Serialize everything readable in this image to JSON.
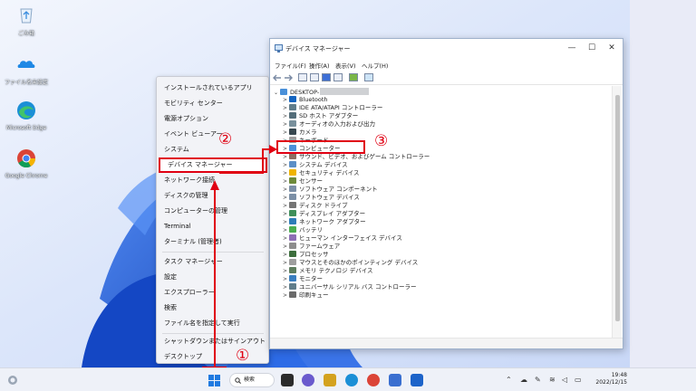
{
  "desktop": {
    "icons": [
      {
        "label": "ごみ箱",
        "icon": "recycle-bin-icon"
      },
      {
        "label": "ファイル名未設定",
        "icon": "onedrive-icon"
      },
      {
        "label": "Microsoft Edge",
        "icon": "edge-icon"
      },
      {
        "label": "Google Chrome",
        "icon": "chrome-icon"
      }
    ]
  },
  "context_menu": {
    "items": [
      "インストールされているアプリ",
      "モビリティ センター",
      "電源オプション",
      "イベント ビューアー",
      "システム",
      "デバイス マネージャー",
      "ネットワーク接続",
      "ディスクの管理",
      "コンピューターの管理",
      "Terminal",
      "ターミナル (管理者)",
      "タスク マネージャー",
      "設定",
      "エクスプローラー",
      "検索",
      "ファイル名を指定して実行",
      "シャットダウンまたはサインアウト",
      "デスクトップ"
    ],
    "highlighted": "デバイス マネージャー"
  },
  "window": {
    "title": "デバイス マネージャー",
    "controls": {
      "minimize": "—",
      "maximize": "☐",
      "close": "✕"
    },
    "menu": [
      "ファイル(F)",
      "操作(A)",
      "表示(V)",
      "ヘルプ(H)"
    ],
    "root": "DESKTOP-",
    "devices": [
      {
        "label": "Bluetooth",
        "icon": "bluetooth-icon",
        "color": "#1565c0"
      },
      {
        "label": "IDE ATA/ATAPI コントローラー",
        "icon": "ide-controller-icon",
        "color": "#607d8b"
      },
      {
        "label": "SD ホスト アダプター",
        "icon": "sd-adapter-icon",
        "color": "#546e7a"
      },
      {
        "label": "オーディオの入力および出力",
        "icon": "speaker-icon",
        "color": "#78909c"
      },
      {
        "label": "カメラ",
        "icon": "camera-icon",
        "color": "#37474f"
      },
      {
        "label": "キーボード",
        "icon": "keyboard-icon",
        "color": "#9e9e9e"
      },
      {
        "label": "コンピューター",
        "icon": "computer-icon",
        "color": "#4a90d9"
      },
      {
        "label": "サウンド、ビデオ、およびゲーム コントローラー",
        "icon": "sound-icon",
        "color": "#8d6e63"
      },
      {
        "label": "システム デバイス",
        "icon": "system-device-icon",
        "color": "#5c8fc7"
      },
      {
        "label": "セキュリティ デバイス",
        "icon": "security-icon",
        "color": "#f0b400"
      },
      {
        "label": "センサー",
        "icon": "sensor-icon",
        "color": "#6d8a3a"
      },
      {
        "label": "ソフトウェア コンポーネント",
        "icon": "software-component-icon",
        "color": "#7b8fa6"
      },
      {
        "label": "ソフトウェア デバイス",
        "icon": "software-device-icon",
        "color": "#7b8fa6"
      },
      {
        "label": "ディスク ドライブ",
        "icon": "disk-drive-icon",
        "color": "#757575"
      },
      {
        "label": "ディスプレイ アダプター",
        "icon": "display-adapter-icon",
        "color": "#3f8f5a"
      },
      {
        "label": "ネットワーク アダプター",
        "icon": "network-adapter-icon",
        "color": "#2e7db8"
      },
      {
        "label": "バッテリ",
        "icon": "battery-icon",
        "color": "#4caf50"
      },
      {
        "label": "ヒューマン インターフェイス デバイス",
        "icon": "hid-icon",
        "color": "#8e6fb5"
      },
      {
        "label": "ファームウェア",
        "icon": "firmware-icon",
        "color": "#8d8d8d"
      },
      {
        "label": "プロセッサ",
        "icon": "processor-icon",
        "color": "#3c6e3c"
      },
      {
        "label": "マウスとそのほかのポインティング デバイス",
        "icon": "mouse-icon",
        "color": "#9e9e9e"
      },
      {
        "label": "メモリ テクノロジ デバイス",
        "icon": "memory-icon",
        "color": "#5d7d5d"
      },
      {
        "label": "モニター",
        "icon": "monitor-icon",
        "color": "#3a7fc0"
      },
      {
        "label": "ユニバーサル シリアル バス コントローラー",
        "icon": "usb-icon",
        "color": "#607d8b"
      },
      {
        "label": "印刷キュー",
        "icon": "printer-icon",
        "color": "#6b6b6b"
      }
    ],
    "highlighted": "キーボード"
  },
  "annotations": {
    "step1": "①",
    "step2": "②",
    "step3": "③"
  },
  "taskbar": {
    "search_label": "検索",
    "time": "19:48",
    "date": "2022/12/15"
  }
}
